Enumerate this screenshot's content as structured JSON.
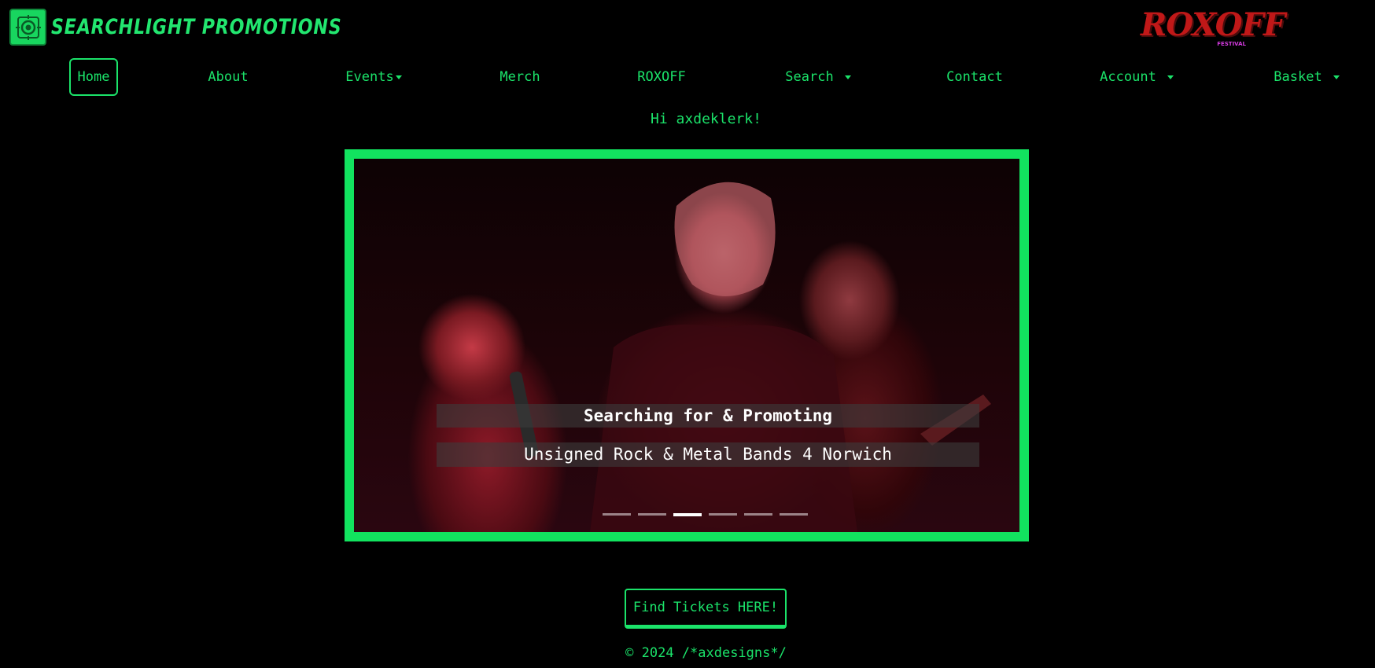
{
  "brand": {
    "name": "SEARCHLIGHT PROMOTIONS",
    "logo_icon": "searchlight-icon"
  },
  "partner_logo": {
    "name": "ROXOFF",
    "sub": "FESTIVAL"
  },
  "nav": {
    "home": "Home",
    "about": "About",
    "events": "Events",
    "merch": "Merch",
    "roxoff": "ROXOFF",
    "search": "Search",
    "contact": "Contact",
    "account": "Account",
    "basket": "Basket"
  },
  "greeting": "Hi axdeklerk!",
  "carousel": {
    "caption_title": "Searching for & Promoting",
    "caption_text": "Unsigned Rock & Metal Bands 4 Norwich",
    "slide_count": 6,
    "active_slide": 3
  },
  "cta": {
    "tickets_label": "Find Tickets HERE!"
  },
  "footer": {
    "text": "© 2024 /*axdesigns*/"
  },
  "colors": {
    "accent": "#1be36a",
    "background": "#000000",
    "carousel_border": "#12e35f"
  }
}
